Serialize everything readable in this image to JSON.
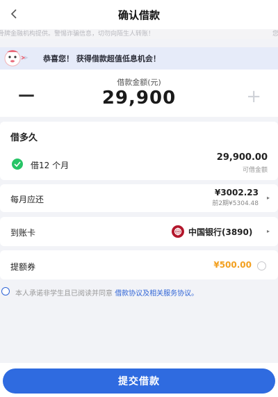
{
  "header": {
    "title": "确认借款"
  },
  "notice": {
    "left_text": "中骨牌金融机构提供。警惕诈骗信息，切勿向陌生人转账！",
    "right_fragment": "您"
  },
  "promo": {
    "text": "恭喜您！ 获得借款超值低息机会！"
  },
  "amount": {
    "label": "借款金额(元)",
    "value": "29,900",
    "minus": "—",
    "plus": "+"
  },
  "term": {
    "title": "借多久",
    "option": "借12 个月",
    "amount": "29,900.00",
    "amount_label": "可借金额"
  },
  "monthly": {
    "label": "每月应还",
    "amount": "¥3002.23",
    "sub": "前2期¥5304.48"
  },
  "bank": {
    "label": "到账卡",
    "name": "中国银行(3890)"
  },
  "coupon": {
    "label": "提额券",
    "amount": "¥500.00"
  },
  "agreement": {
    "prefix": "本人承诺非学生且已阅读并同意",
    "link": "借款协议及相关服务协议。"
  },
  "submit": {
    "label": "提交借款"
  },
  "colors": {
    "primary": "#2f6be0",
    "coupon": "#f2a020",
    "check": "#27c466",
    "bank_logo": "#b3172c"
  }
}
